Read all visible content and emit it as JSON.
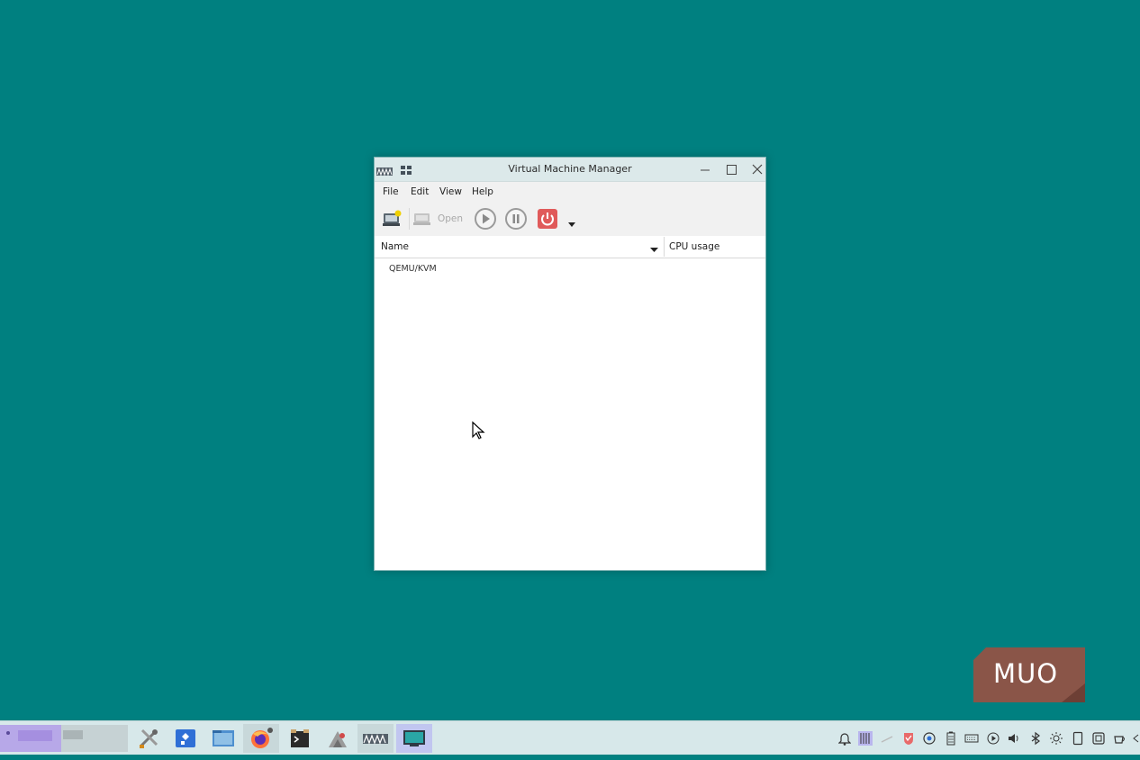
{
  "window": {
    "title": "Virtual Machine Manager",
    "menu": [
      "File",
      "Edit",
      "View",
      "Help"
    ],
    "toolbar": {
      "open_label": "Open"
    },
    "columns": {
      "name": "Name",
      "cpu": "CPU usage"
    },
    "connections": [
      {
        "label": "QEMU/KVM"
      }
    ]
  },
  "watermark": {
    "text": "MUO"
  },
  "colors": {
    "desktop": "#008080",
    "titlebar": "#dce9ea",
    "taskbar": "#d7e8ea",
    "shutdown_red": "#e05a5a",
    "watermark_bg": "#8a5548"
  },
  "taskbar": {
    "apps": [
      "settings-icon",
      "software-center-icon",
      "file-manager-icon",
      "firefox-icon",
      "terminal-icon",
      "installer-icon",
      "virt-manager-icon",
      "virtual-display-icon"
    ],
    "tray": [
      "notifications-icon",
      "clipboard-tray-icon",
      "network-icon",
      "antivirus-icon",
      "updates-icon",
      "battery-icon",
      "keyboard-icon",
      "media-icon",
      "volume-icon",
      "bluetooth-icon",
      "brightness-icon",
      "tablet-icon",
      "screenshot-icon",
      "coffee-icon",
      "more-icon"
    ]
  }
}
